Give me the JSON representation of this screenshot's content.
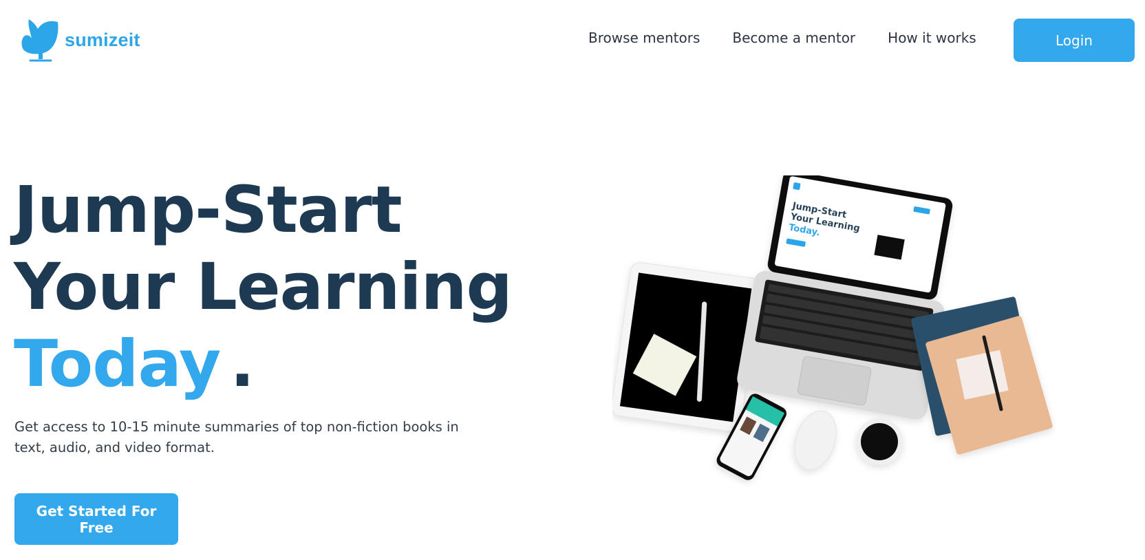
{
  "brand": {
    "name": "sumizeit",
    "logo_icon": "chair-icon",
    "accent": "#34a8ec",
    "dark": "#1d3a52"
  },
  "nav": {
    "items": [
      "Browse mentors",
      "Become a mentor",
      "How it works"
    ],
    "login_label": "Login"
  },
  "hero": {
    "title_line1": "Jump-Start",
    "title_line2": "Your Learning",
    "title_line3_accent": "Today",
    "title_line3_end": ".",
    "subtitle": "Get access to 10-15 minute summaries of top non-fiction books in text, audio, and video format.",
    "cta_label": "Get Started For Free"
  }
}
